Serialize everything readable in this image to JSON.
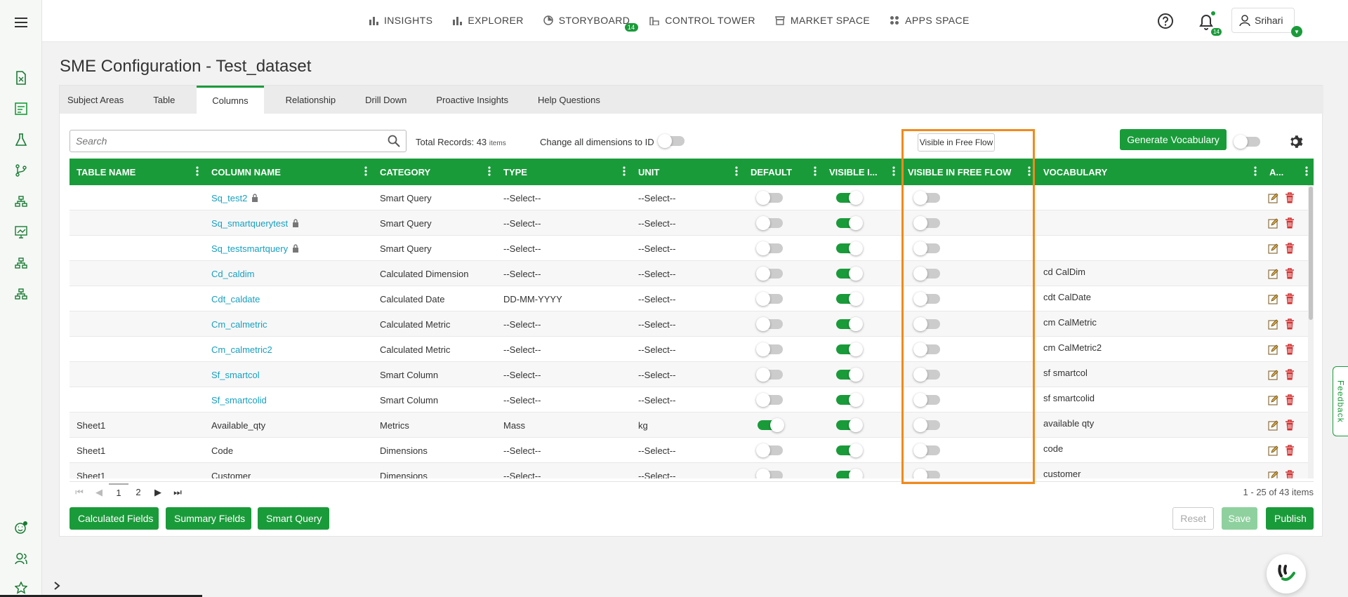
{
  "nav": {
    "items": [
      {
        "label": "INSIGHTS",
        "icon": "bar-chart-icon"
      },
      {
        "label": "EXPLORER",
        "icon": "bar-chart-icon"
      },
      {
        "label": "STORYBOARD",
        "icon": "storyboard-icon",
        "badge": "14"
      },
      {
        "label": "CONTROL TOWER",
        "icon": "control-tower-icon"
      },
      {
        "label": "MARKET SPACE",
        "icon": "market-space-icon"
      },
      {
        "label": "APPS SPACE",
        "icon": "apps-grid-icon"
      }
    ],
    "notifications_badge": "14",
    "user_name": "Srihari"
  },
  "page": {
    "title": "SME Configuration - Test_dataset",
    "tabs": [
      "Subject Areas",
      "Table",
      "Columns",
      "Relationship",
      "Drill Down",
      "Proactive Insights",
      "Help Questions"
    ],
    "active_tab": "Columns"
  },
  "toolbar": {
    "search_placeholder": "Search",
    "total_records_label": "Total Records: 43",
    "total_records_unit": "items",
    "change_dimensions_label": "Change all dimensions to ID",
    "visible_free_flow_button": "Visible in Free Flow",
    "generate_vocabulary_button": "Generate Vocabulary"
  },
  "table": {
    "headers": [
      "TABLE NAME",
      "COLUMN NAME",
      "CATEGORY",
      "TYPE",
      "UNIT",
      "DEFAULT",
      "VISIBLE I...",
      "VISIBLE IN FREE FLOW",
      "VOCABULARY",
      "A..."
    ],
    "rows": [
      {
        "table": "",
        "column": "Sq_test2",
        "link": true,
        "lock": true,
        "category": "Smart Query",
        "type": "--Select--",
        "unit": "--Select--",
        "default": false,
        "visible": true,
        "free_flow": false,
        "vocabulary": ""
      },
      {
        "table": "",
        "column": "Sq_smartquerytest",
        "link": true,
        "lock": true,
        "category": "Smart Query",
        "type": "--Select--",
        "unit": "--Select--",
        "default": false,
        "visible": true,
        "free_flow": false,
        "vocabulary": ""
      },
      {
        "table": "",
        "column": "Sq_testsmartquery",
        "link": true,
        "lock": true,
        "category": "Smart Query",
        "type": "--Select--",
        "unit": "--Select--",
        "default": false,
        "visible": true,
        "free_flow": false,
        "vocabulary": ""
      },
      {
        "table": "",
        "column": "Cd_caldim",
        "link": true,
        "lock": false,
        "category": "Calculated Dimension",
        "type": "--Select--",
        "unit": "--Select--",
        "default": false,
        "visible": true,
        "free_flow": false,
        "vocabulary": "cd CalDim"
      },
      {
        "table": "",
        "column": "Cdt_caldate",
        "link": true,
        "lock": false,
        "category": "Calculated Date",
        "type": "DD-MM-YYYY",
        "unit": "--Select--",
        "default": false,
        "visible": true,
        "free_flow": false,
        "vocabulary": "cdt CalDate"
      },
      {
        "table": "",
        "column": "Cm_calmetric",
        "link": true,
        "lock": false,
        "category": "Calculated Metric",
        "type": "--Select--",
        "unit": "--Select--",
        "default": false,
        "visible": true,
        "free_flow": false,
        "vocabulary": "cm CalMetric"
      },
      {
        "table": "",
        "column": "Cm_calmetric2",
        "link": true,
        "lock": false,
        "category": "Calculated Metric",
        "type": "--Select--",
        "unit": "--Select--",
        "default": false,
        "visible": true,
        "free_flow": false,
        "vocabulary": "cm CalMetric2"
      },
      {
        "table": "",
        "column": "Sf_smartcol",
        "link": true,
        "lock": false,
        "category": "Smart Column",
        "type": "--Select--",
        "unit": "--Select--",
        "default": false,
        "visible": true,
        "free_flow": false,
        "vocabulary": "sf smartcol"
      },
      {
        "table": "",
        "column": "Sf_smartcolid",
        "link": true,
        "lock": false,
        "category": "Smart Column",
        "type": "--Select--",
        "unit": "--Select--",
        "default": false,
        "visible": true,
        "free_flow": false,
        "vocabulary": "sf smartcolid"
      },
      {
        "table": "Sheet1",
        "column": "Available_qty",
        "link": false,
        "lock": false,
        "category": "Metrics",
        "type": "Mass",
        "unit": "kg",
        "default": true,
        "visible": true,
        "free_flow": false,
        "vocabulary": "available qty"
      },
      {
        "table": "Sheet1",
        "column": "Code",
        "link": false,
        "lock": false,
        "category": "Dimensions",
        "type": "--Select--",
        "unit": "--Select--",
        "default": false,
        "visible": true,
        "free_flow": false,
        "vocabulary": "code"
      },
      {
        "table": "Sheet1",
        "column": "Customer",
        "link": false,
        "lock": false,
        "category": "Dimensions",
        "type": "--Select--",
        "unit": "--Select--",
        "default": false,
        "visible": true,
        "free_flow": false,
        "vocabulary": "customer"
      }
    ]
  },
  "pagination": {
    "pages": [
      "1",
      "2"
    ],
    "current": "1",
    "info": "1 - 25 of 43 items"
  },
  "footer": {
    "calculated_fields": "Calculated Fields",
    "summary_fields": "Summary Fields",
    "smart_query": "Smart Query",
    "reset": "Reset",
    "save": "Save",
    "publish": "Publish"
  },
  "feedback_label": "Feedback",
  "colors": {
    "accent": "#1a9b3a",
    "link": "#17a0c0",
    "highlight": "#f18a1c",
    "delete": "#d32f2f"
  }
}
